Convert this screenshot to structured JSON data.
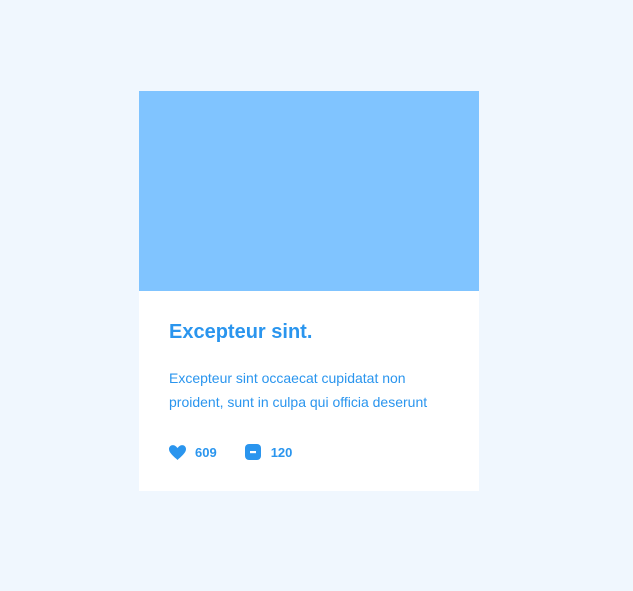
{
  "card": {
    "title": "Excepteur sint.",
    "description": "Excepteur sint occaecat cupidatat non proident, sunt in culpa qui officia deserunt",
    "likes": {
      "icon": "heart-icon",
      "count": "609"
    },
    "comments": {
      "icon": "comment-icon",
      "count": "120"
    }
  },
  "colors": {
    "page_background": "#f0f7fe",
    "image_placeholder": "#80c4ff",
    "accent": "#2a95ee",
    "card_background": "#ffffff"
  }
}
